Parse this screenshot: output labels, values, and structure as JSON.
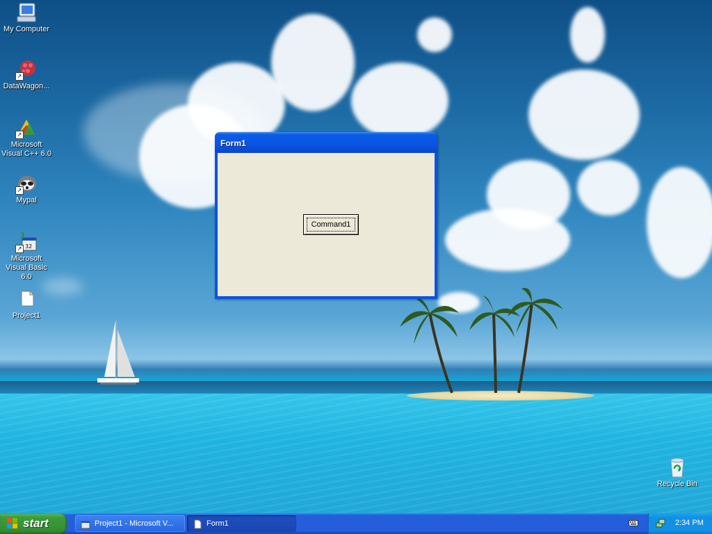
{
  "desktop": {
    "icons": [
      {
        "label": "My Computer",
        "icon": "my-computer-icon"
      },
      {
        "label": "DataWagon...",
        "icon": "datawagon-icon"
      },
      {
        "label": "Microsoft Visual C++ 6.0",
        "icon": "visual-cpp-icon"
      },
      {
        "label": "Mypal",
        "icon": "mypal-icon"
      },
      {
        "label": "Microsoft Visual Basic 6.0",
        "icon": "visual-basic-icon"
      },
      {
        "label": "Project1",
        "icon": "project-file-icon"
      },
      {
        "label": "Recycle Bin",
        "icon": "recycle-bin-icon"
      }
    ]
  },
  "window": {
    "title": "Form1",
    "button_label": "Command1"
  },
  "taskbar": {
    "start_label": "start",
    "tasks": [
      {
        "label": "Project1 - Microsoft V...",
        "icon": "vb-project-icon",
        "active": false
      },
      {
        "label": "Form1",
        "icon": "form-window-icon",
        "active": true
      }
    ],
    "clock": "2:34 PM"
  },
  "colors": {
    "titlebar": "#0a54e3",
    "form_background": "#ece9d8",
    "taskbar": "#245edb",
    "start_button": "#3c9c3c",
    "tray": "#1290e6"
  }
}
